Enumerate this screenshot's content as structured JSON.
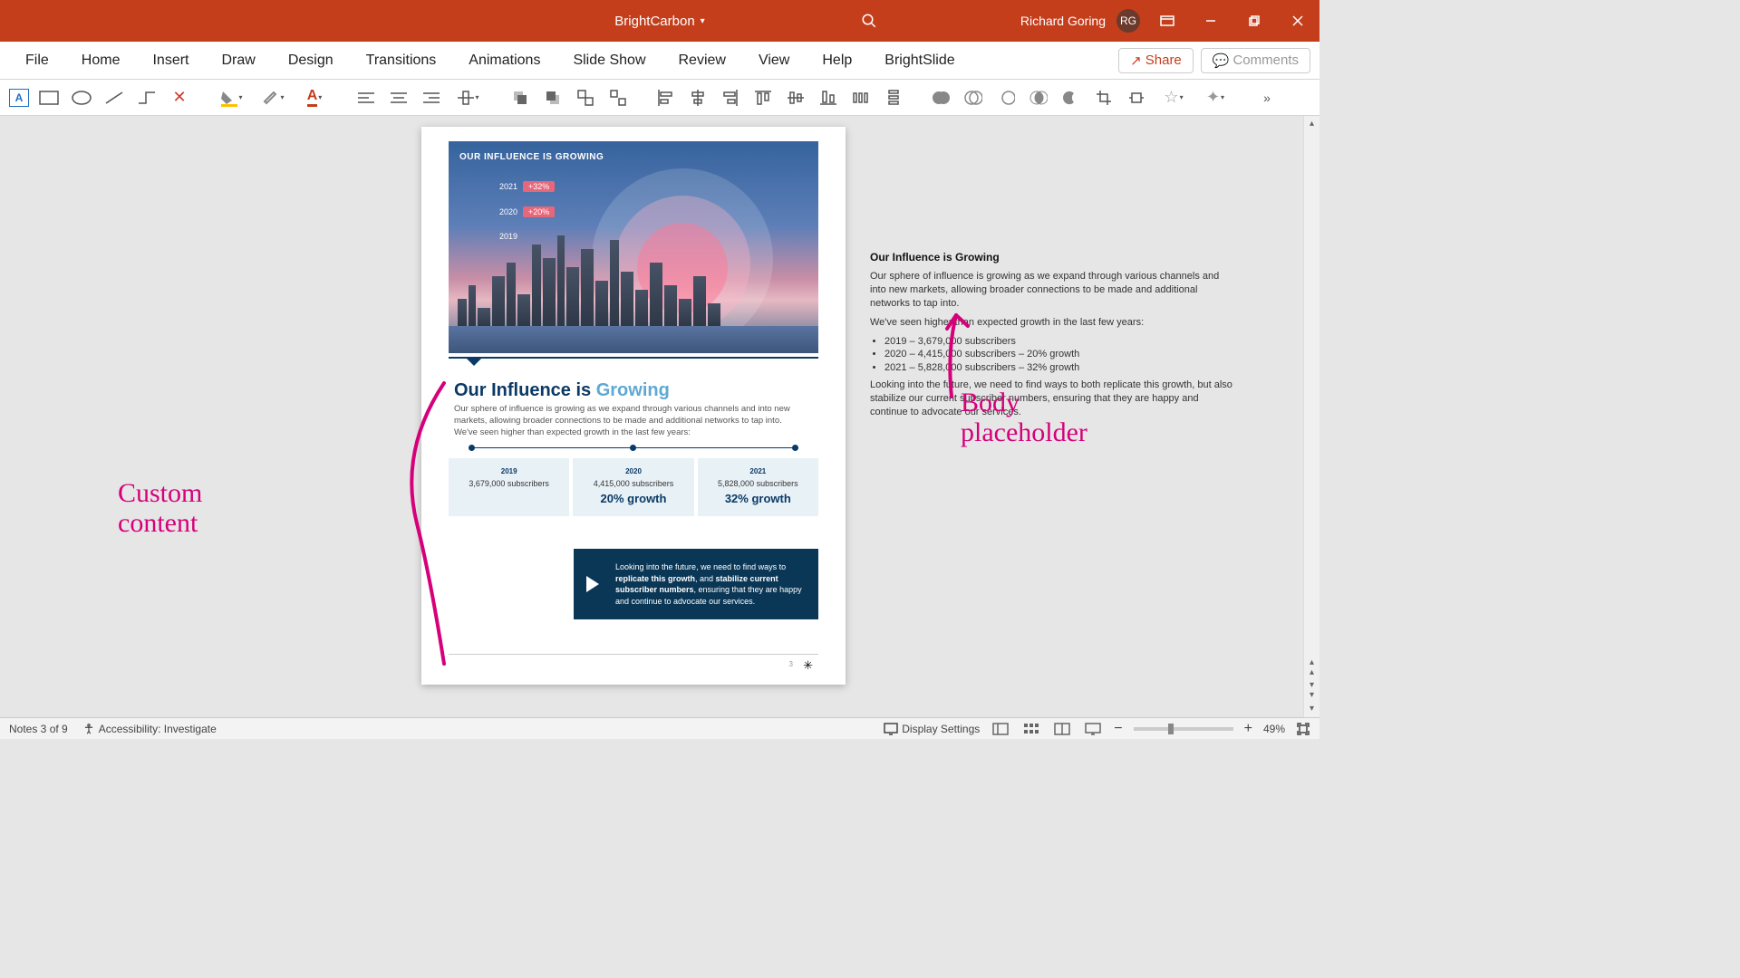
{
  "titlebar": {
    "document": "BrightCarbon",
    "user": "Richard Goring",
    "initials": "RG"
  },
  "ribbon": {
    "tabs": [
      "File",
      "Home",
      "Insert",
      "Draw",
      "Design",
      "Transitions",
      "Animations",
      "Slide Show",
      "Review",
      "View",
      "Help",
      "BrightSlide"
    ],
    "share": "Share",
    "comments": "Comments"
  },
  "hero": {
    "title": "OUR INFLUENCE IS GROWING",
    "rows": [
      {
        "year": "2021",
        "badge": "+32%"
      },
      {
        "year": "2020",
        "badge": "+20%"
      },
      {
        "year": "2019",
        "badge": ""
      }
    ]
  },
  "page": {
    "h2a": "Our Influence is ",
    "h2b": "Growing",
    "p1": "Our sphere of influence is growing as we expand through various channels and into new markets, allowing broader connections to be made and additional networks to tap into.",
    "p2": "We've seen higher than expected growth in the last few years:",
    "cards": [
      {
        "yr": "2019",
        "sub": "3,679,000 subscribers",
        "gr": ""
      },
      {
        "yr": "2020",
        "sub": "4,415,000 subscribers",
        "gr": "20% growth"
      },
      {
        "yr": "2021",
        "sub": "5,828,000 subscribers",
        "gr": "32% growth"
      }
    ],
    "navy_a": "Looking into the future, we need to find ways to ",
    "navy_b": "replicate this growth",
    "navy_c": ", and ",
    "navy_d": "stabilize current subscriber numbers",
    "navy_e": ", ensuring that they are happy and continue to advocate our services.",
    "pagenum": "3"
  },
  "body": {
    "h": "Our Influence is Growing",
    "p1": "Our sphere of influence is growing as we expand through various channels and into new markets, allowing broader connections to be made and additional networks to tap into.",
    "p2": "We've seen higher than expected growth in the last few years:",
    "b1": "2019 – 3,679,000 subscribers",
    "b2": "2020 – 4,415,000 subscribers – 20% growth",
    "b3": "2021 – 5,828,000 subscribers – 32% growth",
    "p3": "Looking into the future, we need to find ways to both replicate this growth, but also stabilize our current subscriber numbers, ensuring that they are happy and continue to advocate our services."
  },
  "annotations": {
    "left": "Custom\ncontent",
    "right": "Body\nplaceholder"
  },
  "status": {
    "notes": "Notes 3 of 9",
    "access": "Accessibility: Investigate",
    "display": "Display Settings",
    "zoom": "49%"
  }
}
